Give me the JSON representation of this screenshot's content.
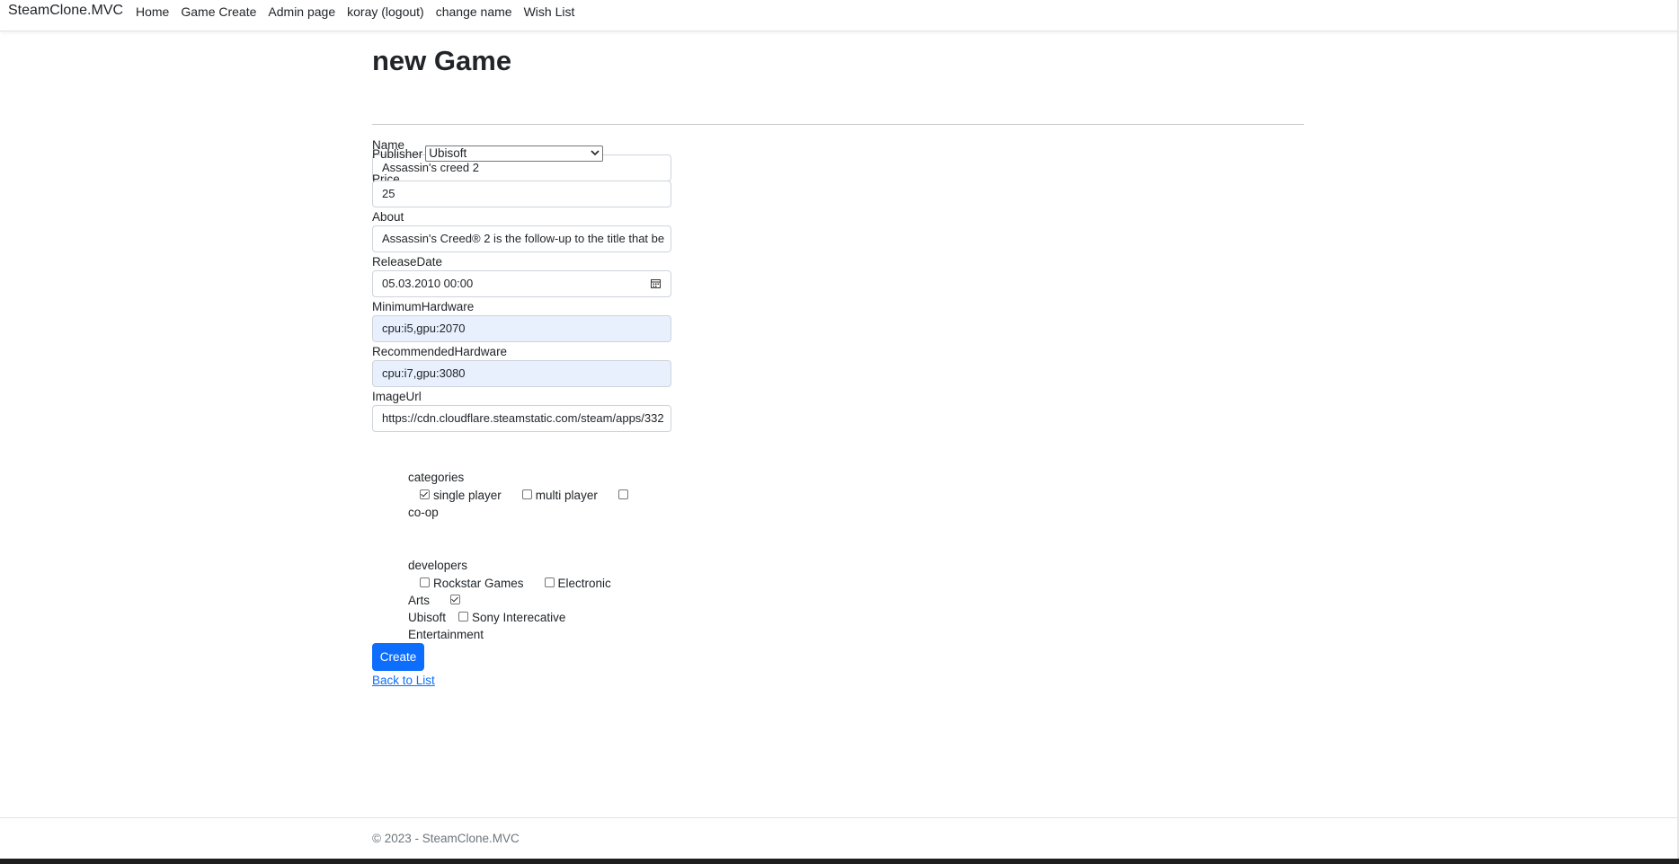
{
  "navbar": {
    "brand": "SteamClone.MVC",
    "links": [
      "Home",
      "Game Create",
      "Admin page",
      "koray (logout)",
      "change name",
      "Wish List"
    ]
  },
  "page": {
    "title": "new Game"
  },
  "form": {
    "name": {
      "label": "Name",
      "value": "Assassin's creed 2"
    },
    "publisher": {
      "label": "Publisher",
      "selected": "Ubisoft"
    },
    "price": {
      "label": "Price",
      "value": "25"
    },
    "about": {
      "label": "About",
      "value": "Assassin's Creed® 2 is the follow-up to the title that be"
    },
    "release_date": {
      "label": "ReleaseDate",
      "value": "05.03.2010 00:00"
    },
    "minimum_hardware": {
      "label": "MinimumHardware",
      "value": "cpu:i5,gpu:2070"
    },
    "recommended_hardware": {
      "label": "RecommendedHardware",
      "value": "cpu:i7,gpu:3080"
    },
    "image_url": {
      "label": "ImageUrl",
      "value": "https://cdn.cloudflare.steamstatic.com/steam/apps/332"
    },
    "categories": {
      "title": "categories",
      "items": [
        {
          "label": "single player",
          "checked": true
        },
        {
          "label": "multi player",
          "checked": false
        },
        {
          "label": "co-op",
          "checked": false
        }
      ]
    },
    "developers": {
      "title": "developers",
      "items": [
        {
          "label": "Rockstar Games",
          "checked": false
        },
        {
          "label": "Electronic Arts",
          "checked": false
        },
        {
          "label": "Ubisoft",
          "checked": true
        },
        {
          "label": "Sony Interecative Entertainment",
          "checked": false
        }
      ]
    },
    "submit_label": "Create",
    "back_link": "Back to List"
  },
  "footer": {
    "text": "© 2023 - SteamClone.MVC"
  },
  "colors": {
    "primary": "#0d6efd",
    "autofill": "#e8f0fe",
    "muted": "#6c757d"
  },
  "icons": {
    "calendar": "calendar-icon",
    "select_arrow": "chevron-down-icon"
  }
}
